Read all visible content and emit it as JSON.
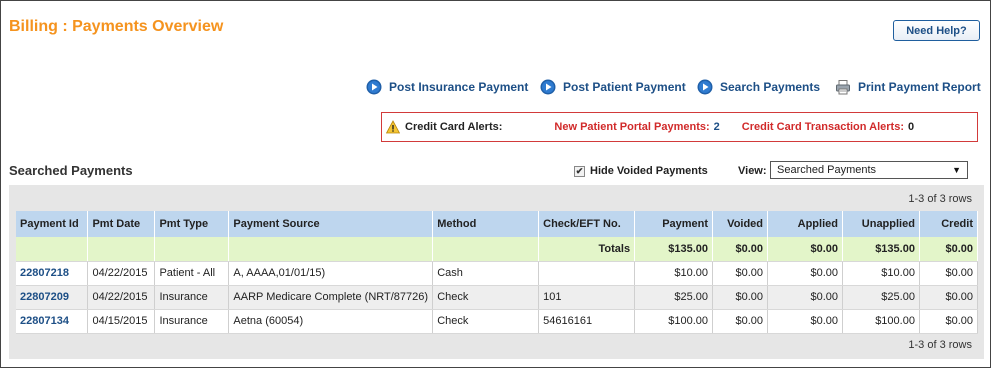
{
  "header": {
    "title": "Billing : Payments Overview",
    "help_label": "Need Help?"
  },
  "actions": {
    "post_insurance": "Post Insurance Payment",
    "post_patient": "Post Patient Payment",
    "search": "Search Payments",
    "print": "Print Payment Report"
  },
  "alerts": {
    "label": "Credit Card Alerts:",
    "portal_label": "New Patient Portal Payments:",
    "portal_count": "2",
    "cc_label": "Credit Card Transaction Alerts:",
    "cc_count": "0"
  },
  "section": {
    "title": "Searched Payments",
    "hide_voided_label": "Hide Voided Payments",
    "hide_voided_checked": true,
    "view_label": "View:",
    "view_value": "Searched Payments"
  },
  "grid": {
    "rows_count_top": "1-3 of 3 rows",
    "rows_count_bottom": "1-3 of 3 rows",
    "columns": [
      "Payment Id",
      "Pmt Date",
      "Pmt Type",
      "Payment Source",
      "Method",
      "Check/EFT No.",
      "Payment",
      "Voided",
      "Applied",
      "Unapplied",
      "Credit"
    ],
    "totals": {
      "label": "Totals",
      "payment": "$135.00",
      "voided": "$0.00",
      "applied": "$0.00",
      "unapplied": "$135.00",
      "credit": "$0.00"
    },
    "rows": [
      {
        "id": "22807218",
        "date": "04/22/2015",
        "type": "Patient - All",
        "source": "A, AAAA,01/01/15)",
        "method": "Cash",
        "check": "",
        "payment": "$10.00",
        "voided": "$0.00",
        "applied": "$0.00",
        "unapplied": "$10.00",
        "credit": "$0.00"
      },
      {
        "id": "22807209",
        "date": "04/22/2015",
        "type": "Insurance",
        "source": "AARP Medicare Complete (NRT/87726)",
        "method": "Check",
        "check": "101",
        "payment": "$25.00",
        "voided": "$0.00",
        "applied": "$0.00",
        "unapplied": "$25.00",
        "credit": "$0.00"
      },
      {
        "id": "22807134",
        "date": "04/15/2015",
        "type": "Insurance",
        "source": "Aetna (60054)",
        "method": "Check",
        "check": "54616161",
        "payment": "$100.00",
        "voided": "$0.00",
        "applied": "$0.00",
        "unapplied": "$100.00",
        "credit": "$0.00"
      }
    ]
  },
  "colors": {
    "accent_orange": "#f5931e",
    "link_blue": "#1d4f86",
    "alert_red": "#d12a2a",
    "header_blue": "#bed6ee",
    "totals_green": "#e3f5c9"
  }
}
